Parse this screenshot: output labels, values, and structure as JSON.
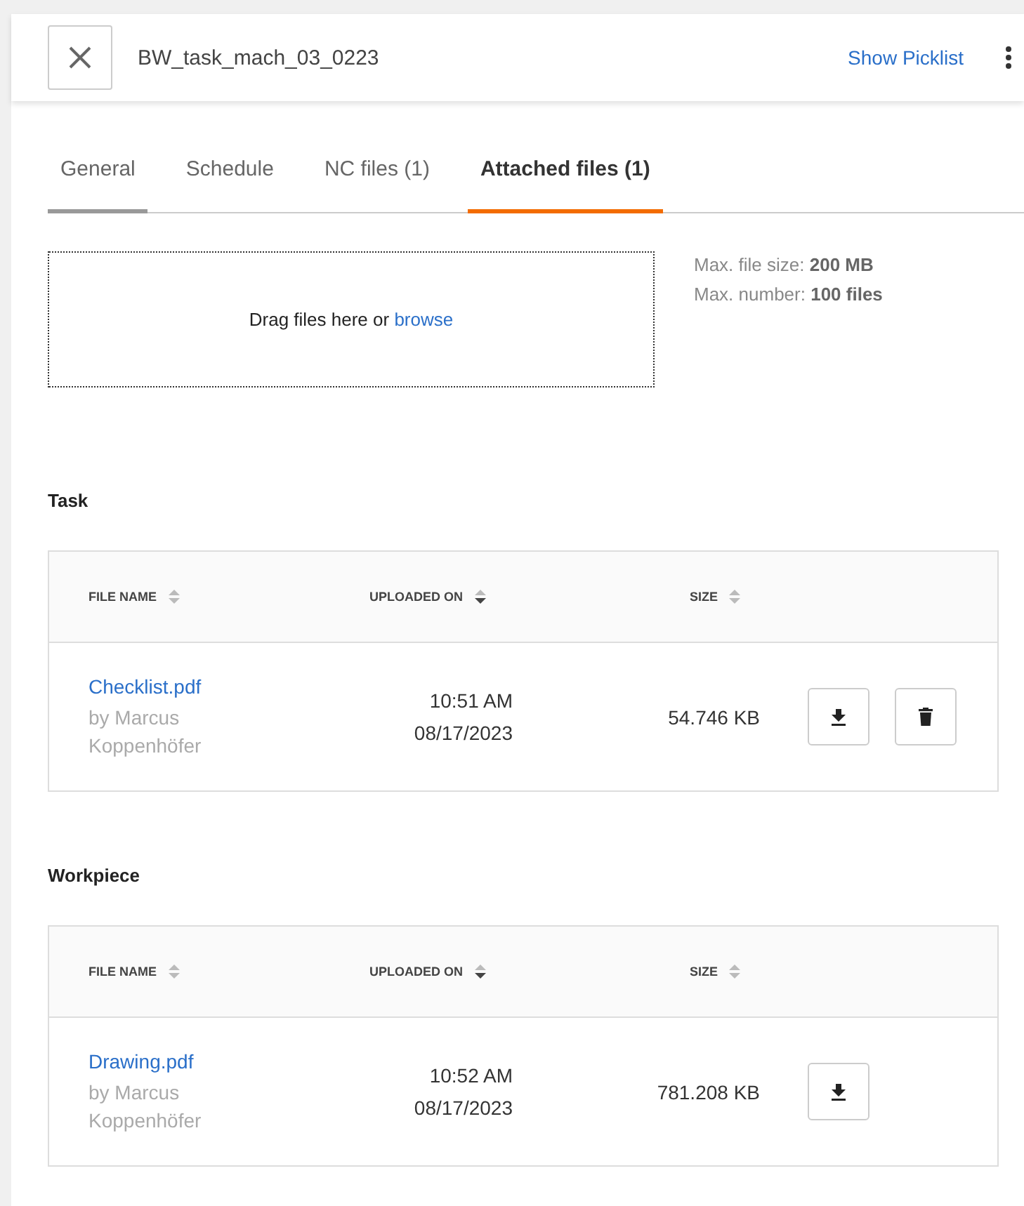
{
  "header": {
    "title": "BW_task_mach_03_0223",
    "action": "Show Picklist"
  },
  "tabs": [
    {
      "label": "General",
      "selected": false,
      "hovered": true
    },
    {
      "label": "Schedule",
      "selected": false,
      "hovered": false
    },
    {
      "label": "NC files (1)",
      "selected": false,
      "hovered": false
    },
    {
      "label": "Attached files (1)",
      "selected": true,
      "hovered": false
    }
  ],
  "dropzone": {
    "text": "Drag files here or",
    "link": "browse"
  },
  "limits": [
    {
      "label": "Max. file size:",
      "value": "200 MB"
    },
    {
      "label": "Max. number:",
      "value": "100 files"
    }
  ],
  "sections": [
    {
      "title": "Task",
      "columns": [
        {
          "label": "FILE NAME",
          "sorted": false
        },
        {
          "label": "UPLOADED ON",
          "sorted": true
        },
        {
          "label": "SIZE",
          "sorted": false
        }
      ],
      "rows": [
        {
          "name": "Checklist.pdf",
          "author": "by Marcus Koppenhöfer",
          "time": "10:51 AM",
          "date": "08/17/2023",
          "size": "54.746 KB",
          "actions": [
            {
              "kind": "download"
            },
            {
              "kind": "delete"
            }
          ]
        }
      ]
    },
    {
      "title": "Workpiece",
      "columns": [
        {
          "label": "FILE NAME",
          "sorted": false
        },
        {
          "label": "UPLOADED ON",
          "sorted": true
        },
        {
          "label": "SIZE",
          "sorted": false
        }
      ],
      "rows": [
        {
          "name": "Drawing.pdf",
          "author": "by Marcus Koppenhöfer",
          "time": "10:52 AM",
          "date": "08/17/2023",
          "size": "781.208 KB",
          "actions": [
            {
              "kind": "download"
            }
          ]
        }
      ]
    }
  ]
}
